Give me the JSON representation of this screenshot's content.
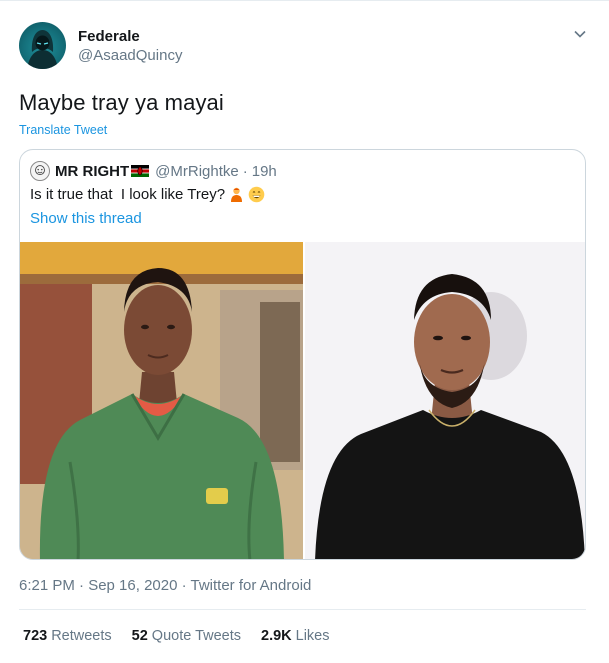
{
  "author": {
    "name": "Federale",
    "handle": "@AsaadQuincy",
    "avatar_icon": "hooded-figure-icon"
  },
  "tweet": {
    "text": "Maybe tray ya mayai",
    "translate_label": "Translate Tweet"
  },
  "quoted": {
    "name": "MR RIGHT",
    "flag_icon": "kenya-flag-icon",
    "handle": "@MrRightke",
    "separator": "·",
    "time": "19h",
    "text": "Is it true that  I look like Trey?",
    "emojis": [
      "person-icon",
      "grinning-face-icon"
    ],
    "thread_link": "Show this thread",
    "photos": [
      "photo-man-green-sweater",
      "photo-man-black-tshirt"
    ]
  },
  "meta": {
    "timestamp": "6:21 PM · Sep 16, 2020 · Twitter for Android"
  },
  "stats": {
    "retweets_count": "723",
    "retweets_label": "Retweets",
    "quotes_count": "52",
    "quotes_label": "Quote Tweets",
    "likes_count": "2.9K",
    "likes_label": "Likes"
  },
  "colors": {
    "link": "#1b95e0",
    "secondary": "#657786",
    "text": "#14171a",
    "border": "#ccd6dd"
  }
}
